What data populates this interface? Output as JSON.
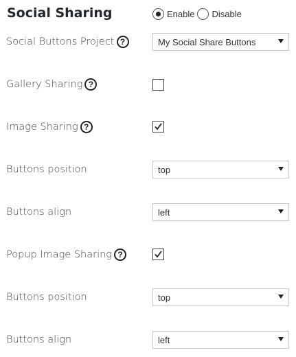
{
  "section": {
    "title": "Social Sharing",
    "radio": {
      "selected": "Enable",
      "options": [
        "Enable",
        "Disable"
      ]
    }
  },
  "rows": {
    "project": {
      "label": "Social Buttons Project",
      "value": "My Social Share Buttons"
    },
    "gallery": {
      "label": "Gallery Sharing",
      "checked": false
    },
    "image": {
      "label": "Image Sharing",
      "checked": true
    },
    "image_position": {
      "label": "Buttons position",
      "value": "top"
    },
    "image_align": {
      "label": "Buttons align",
      "value": "left"
    },
    "popup": {
      "label": "Popup Image Sharing",
      "checked": true
    },
    "popup_position": {
      "label": "Buttons position",
      "value": "top"
    },
    "popup_align": {
      "label": "Buttons align",
      "value": "left"
    }
  },
  "icons": {
    "help": "question-mark-circle-icon",
    "help_glyph": "?",
    "select_arrow": "chevron-down-icon",
    "check": "checkmark-icon"
  }
}
